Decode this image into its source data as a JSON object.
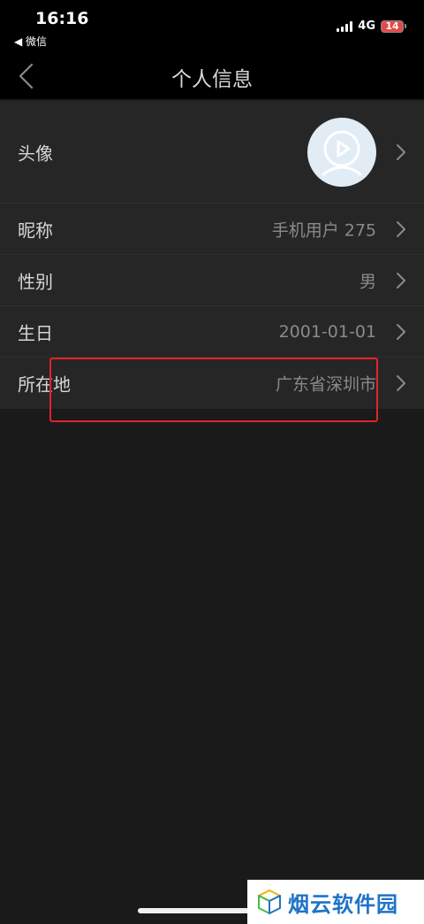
{
  "status_bar": {
    "time": "16:16",
    "back_app": "◀ 微信",
    "network": "4G",
    "battery": "14"
  },
  "nav": {
    "title": "个人信息"
  },
  "rows": [
    {
      "label": "头像",
      "value": ""
    },
    {
      "label": "昵称",
      "value": "手机用户 275"
    },
    {
      "label": "性别",
      "value": "男"
    },
    {
      "label": "生日",
      "value": "2001-01-01"
    },
    {
      "label": "所在地",
      "value": "广东省深圳市"
    }
  ],
  "watermark": {
    "text": "烟云软件园"
  },
  "colors": {
    "background": "#1a1a1a",
    "list_background": "#262626",
    "highlight": "#e0242a",
    "watermark_text": "#1f73c7"
  }
}
